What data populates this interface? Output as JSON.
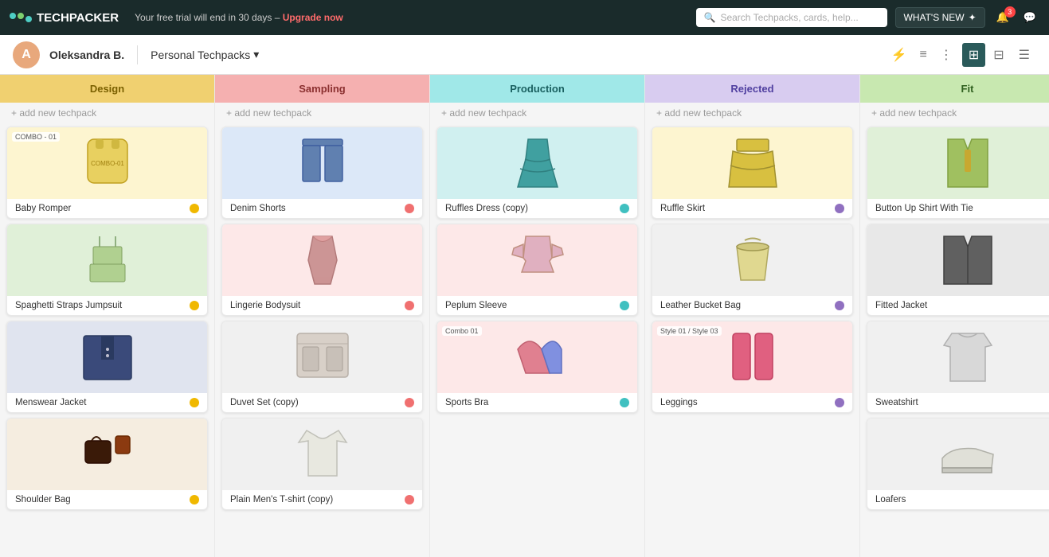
{
  "topnav": {
    "brand": "TECHPACKER",
    "trial_msg": "Your free trial will end in 30 days –",
    "upgrade_label": "Upgrade now",
    "search_placeholder": "Search Techpacks, cards, help...",
    "whats_new_label": "WHAT'S NEW",
    "notif_count": "3"
  },
  "subnav": {
    "avatar_initials": "A",
    "user_name": "Oleksandra B.",
    "workspace_name": "Personal Techpacks"
  },
  "columns": [
    {
      "id": "design",
      "label": "Design",
      "class": "design",
      "cards": [
        {
          "title": "Baby Romper",
          "bg": "bg-yellow",
          "dot": "dot-yellow",
          "badge": "COMBO - 01"
        },
        {
          "title": "Spaghetti Straps Jumpsuit",
          "bg": "bg-green",
          "dot": "dot-yellow",
          "badge": null
        },
        {
          "title": "Menswear Jacket",
          "bg": "bg-navy",
          "dot": "dot-yellow",
          "badge": null
        },
        {
          "title": "Shoulder Bag",
          "bg": "bg-brown",
          "dot": "dot-yellow",
          "badge": null
        },
        {
          "title": "...",
          "bg": "bg-brown",
          "dot": "dot-yellow",
          "badge": null
        }
      ]
    },
    {
      "id": "sampling",
      "label": "Sampling",
      "class": "sampling",
      "cards": [
        {
          "title": "Denim Shorts",
          "bg": "bg-blue",
          "dot": "dot-pink",
          "badge": null
        },
        {
          "title": "Lingerie Bodysuit",
          "bg": "bg-pink",
          "dot": "dot-pink",
          "badge": null
        },
        {
          "title": "Duvet Set (copy)",
          "bg": "bg-gray",
          "dot": "dot-pink",
          "badge": null
        },
        {
          "title": "Plain Men's T-shirt (copy)",
          "bg": "bg-gray",
          "dot": "dot-pink",
          "badge": null
        }
      ]
    },
    {
      "id": "production",
      "label": "Production",
      "class": "production",
      "cards": [
        {
          "title": "Ruffles Dress (copy)",
          "bg": "bg-teal",
          "dot": "dot-teal",
          "badge": null
        },
        {
          "title": "Peplum Sleeve",
          "bg": "bg-pink",
          "dot": "dot-teal",
          "badge": null
        },
        {
          "title": "Sports Bra",
          "bg": "bg-pink",
          "dot": "dot-teal",
          "badge": "Combo 01"
        }
      ]
    },
    {
      "id": "rejected",
      "label": "Rejected",
      "class": "rejected",
      "cards": [
        {
          "title": "Ruffle Skirt",
          "bg": "bg-yellow",
          "dot": "dot-purple",
          "badge": null
        },
        {
          "title": "Leather Bucket Bag",
          "bg": "bg-gray",
          "dot": "dot-purple",
          "badge": null
        },
        {
          "title": "Leggings",
          "bg": "bg-pink",
          "dot": "dot-purple",
          "badge": "Style 01 / Style 03"
        }
      ]
    },
    {
      "id": "fit",
      "label": "Fit",
      "class": "fit",
      "cards": [
        {
          "title": "Button Up Shirt With Tie",
          "bg": "bg-green",
          "dot": "dot-purple",
          "badge": null
        },
        {
          "title": "Fitted Jacket",
          "bg": "bg-darkgray",
          "dot": "dot-purple",
          "badge": null
        },
        {
          "title": "Sweatshirt",
          "bg": "bg-gray",
          "dot": "dot-purple",
          "badge": null
        },
        {
          "title": "Loafers",
          "bg": "bg-gray",
          "dot": "dot-purple",
          "badge": null
        },
        {
          "title": "...",
          "bg": "bg-gray",
          "dot": "dot-purple",
          "badge": null
        }
      ]
    }
  ],
  "add_label": "+ add new techpack"
}
